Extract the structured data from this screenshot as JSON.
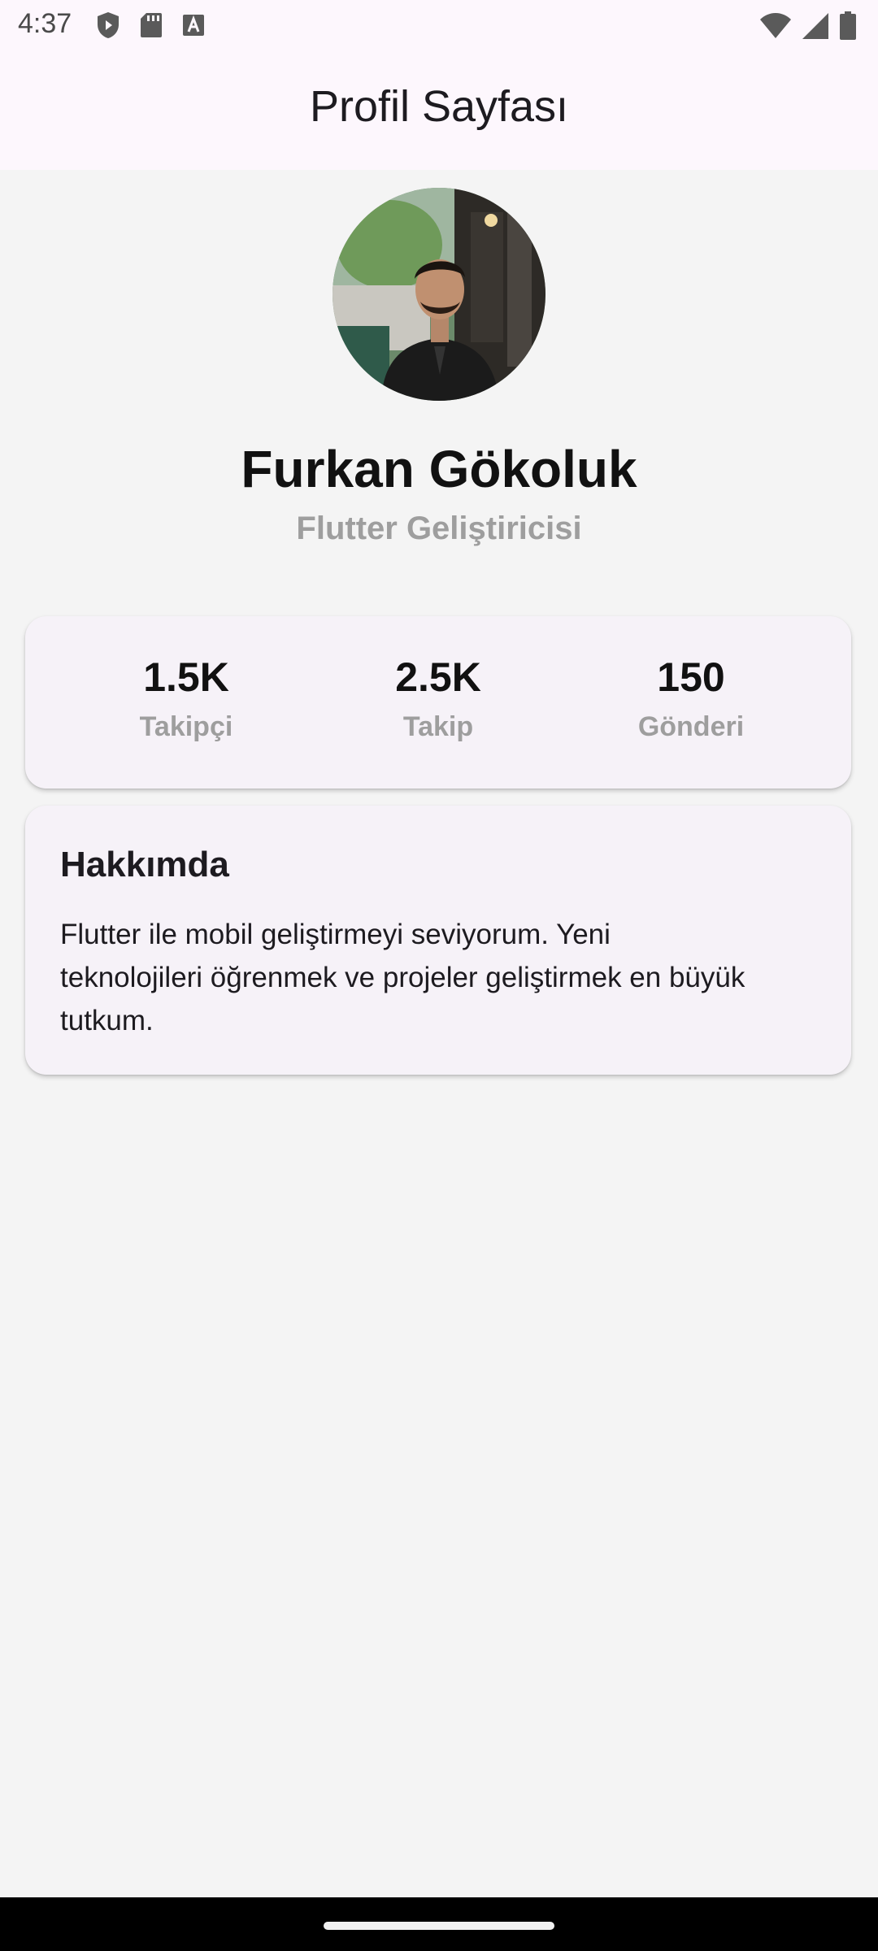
{
  "status_bar": {
    "time": "4:37",
    "left_icons": [
      "shield-play-icon",
      "sd-card-icon",
      "text-a-icon"
    ],
    "right_icons": [
      "wifi-icon",
      "cellular-signal-icon",
      "battery-icon"
    ]
  },
  "app_bar": {
    "title": "Profil Sayfası"
  },
  "profile": {
    "avatar": "profile-photo",
    "name": "Furkan Gökoluk",
    "role": "Flutter Geliştiricisi"
  },
  "stats": [
    {
      "value": "1.5K",
      "label": "Takipçi"
    },
    {
      "value": "2.5K",
      "label": "Takip"
    },
    {
      "value": "150",
      "label": "Gönderi"
    }
  ],
  "about": {
    "title": "Hakkımda",
    "lines": [
      "Flutter ile mobil geliştirmeyi seviyorum. Yeni",
      "teknolojileri öğrenmek ve projeler geliştirmek en büyük",
      "tutkum."
    ]
  },
  "colors": {
    "app_bar_bg": "#fdf7fd",
    "page_bg": "#f4f4f4",
    "card_bg": "#f6f2f8",
    "muted_text": "#9e9e9e"
  }
}
